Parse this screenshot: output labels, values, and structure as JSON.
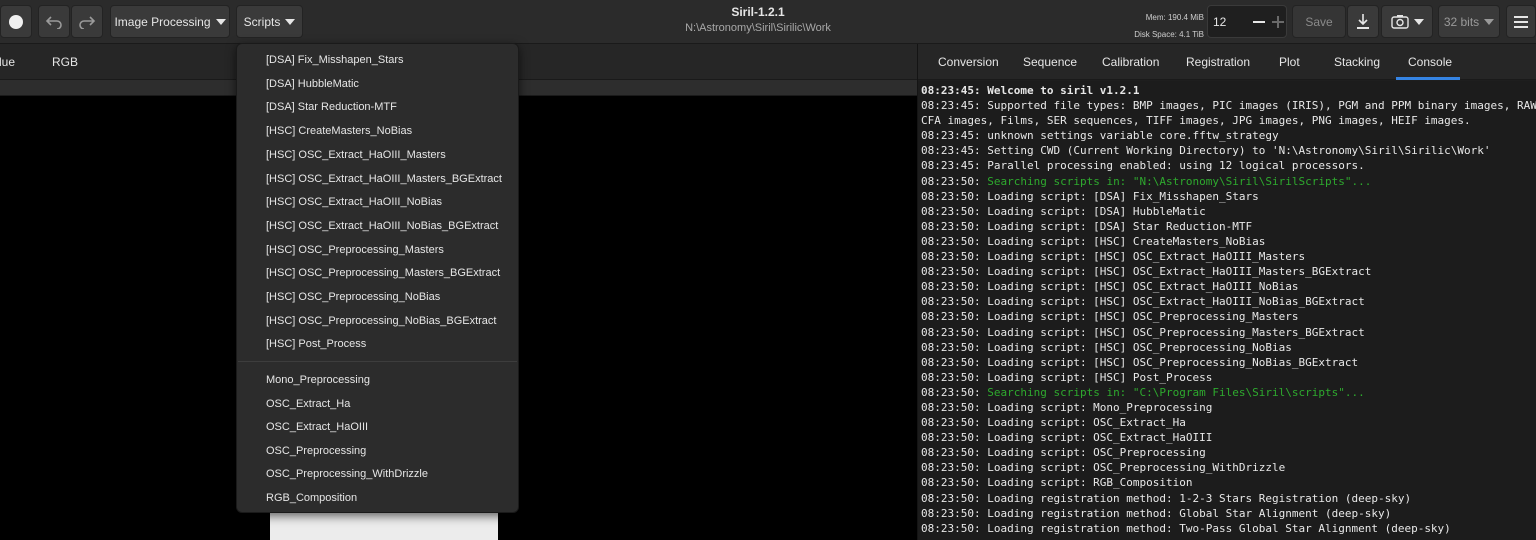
{
  "header": {
    "app_title": "Siril-1.2.1",
    "subtitle": "N:\\Astronomy\\Siril\\Sirilic\\Work",
    "image_processing_label": "Image Processing",
    "scripts_label": "Scripts",
    "memory": "Mem: 190.4 MiB",
    "disk_space": "Disk Space: 4.1 TiB",
    "threads_value": "12",
    "save_label": "Save",
    "bits_label": "32 bits"
  },
  "image_view": {
    "tabs": [
      "lue",
      "RGB"
    ]
  },
  "right_panel": {
    "tabs": [
      "Conversion",
      "Sequence",
      "Calibration",
      "Registration",
      "Plot",
      "Stacking",
      "Console"
    ],
    "active_tab": "Console"
  },
  "console": {
    "lines": [
      {
        "text": "08:23:45: Welcome to siril v1.2.1",
        "style": "bold"
      },
      {
        "text": "08:23:45: Supported file types: BMP images, PIC images (IRIS), PGM and PPM binary images, RAW",
        "style": "normal"
      },
      {
        "text": "CFA images, Films, SER sequences, TIFF images, JPG images, PNG images, HEIF images.",
        "style": "normal"
      },
      {
        "text": "08:23:45: unknown settings variable core.fftw_strategy",
        "style": "normal"
      },
      {
        "text": "08:23:45: Setting CWD (Current Working Directory) to 'N:\\Astronomy\\Siril\\Sirilic\\Work'",
        "style": "normal"
      },
      {
        "text": "08:23:45: Parallel processing enabled: using 12 logical processors.",
        "style": "normal"
      },
      {
        "prefix": "08:23:50: ",
        "text": "Searching scripts in: \"N:\\Astronomy\\Siril\\SirilScripts\"...",
        "style": "green"
      },
      {
        "text": "08:23:50: Loading script: [DSA] Fix_Misshapen_Stars",
        "style": "normal"
      },
      {
        "text": "08:23:50: Loading script: [DSA] HubbleMatic",
        "style": "normal"
      },
      {
        "text": "08:23:50: Loading script: [DSA] Star Reduction-MTF",
        "style": "normal"
      },
      {
        "text": "08:23:50: Loading script: [HSC] CreateMasters_NoBias",
        "style": "normal"
      },
      {
        "text": "08:23:50: Loading script: [HSC] OSC_Extract_HaOIII_Masters",
        "style": "normal"
      },
      {
        "text": "08:23:50: Loading script: [HSC] OSC_Extract_HaOIII_Masters_BGExtract",
        "style": "normal"
      },
      {
        "text": "08:23:50: Loading script: [HSC] OSC_Extract_HaOIII_NoBias",
        "style": "normal"
      },
      {
        "text": "08:23:50: Loading script: [HSC] OSC_Extract_HaOIII_NoBias_BGExtract",
        "style": "normal"
      },
      {
        "text": "08:23:50: Loading script: [HSC] OSC_Preprocessing_Masters",
        "style": "normal"
      },
      {
        "text": "08:23:50: Loading script: [HSC] OSC_Preprocessing_Masters_BGExtract",
        "style": "normal"
      },
      {
        "text": "08:23:50: Loading script: [HSC] OSC_Preprocessing_NoBias",
        "style": "normal"
      },
      {
        "text": "08:23:50: Loading script: [HSC] OSC_Preprocessing_NoBias_BGExtract",
        "style": "normal"
      },
      {
        "text": "08:23:50: Loading script: [HSC] Post_Process",
        "style": "normal"
      },
      {
        "prefix": "08:23:50: ",
        "text": "Searching scripts in: \"C:\\Program Files\\Siril\\scripts\"...",
        "style": "green"
      },
      {
        "text": "08:23:50: Loading script: Mono_Preprocessing",
        "style": "normal"
      },
      {
        "text": "08:23:50: Loading script: OSC_Extract_Ha",
        "style": "normal"
      },
      {
        "text": "08:23:50: Loading script: OSC_Extract_HaOIII",
        "style": "normal"
      },
      {
        "text": "08:23:50: Loading script: OSC_Preprocessing",
        "style": "normal"
      },
      {
        "text": "08:23:50: Loading script: OSC_Preprocessing_WithDrizzle",
        "style": "normal"
      },
      {
        "text": "08:23:50: Loading script: RGB_Composition",
        "style": "normal"
      },
      {
        "text": "08:23:50: Loading registration method: 1-2-3 Stars Registration (deep-sky)",
        "style": "normal"
      },
      {
        "text": "08:23:50: Loading registration method: Global Star Alignment (deep-sky)",
        "style": "normal"
      },
      {
        "text": "08:23:50: Loading registration method: Two-Pass Global Star Alignment (deep-sky)",
        "style": "normal"
      }
    ]
  },
  "scripts_menu": {
    "group1": [
      "[DSA] Fix_Misshapen_Stars",
      "[DSA] HubbleMatic",
      "[DSA] Star Reduction-MTF",
      "[HSC] CreateMasters_NoBias",
      "[HSC] OSC_Extract_HaOIII_Masters",
      "[HSC] OSC_Extract_HaOIII_Masters_BGExtract",
      "[HSC] OSC_Extract_HaOIII_NoBias",
      "[HSC] OSC_Extract_HaOIII_NoBias_BGExtract",
      "[HSC] OSC_Preprocessing_Masters",
      "[HSC] OSC_Preprocessing_Masters_BGExtract",
      "[HSC] OSC_Preprocessing_NoBias",
      "[HSC] OSC_Preprocessing_NoBias_BGExtract",
      "[HSC] Post_Process"
    ],
    "group2": [
      "Mono_Preprocessing",
      "OSC_Extract_Ha",
      "OSC_Extract_HaOIII",
      "OSC_Preprocessing",
      "OSC_Preprocessing_WithDrizzle",
      "RGB_Composition"
    ]
  },
  "icons": {
    "record": "record-icon",
    "undo": "undo-icon",
    "redo": "redo-icon",
    "export": "download-icon",
    "snapshot": "camera-icon",
    "menu": "hamburger-menu-icon"
  },
  "colors": {
    "accent": "#3584e4",
    "console_highlight": "#2ea92e",
    "background": "#1e1e1e"
  }
}
